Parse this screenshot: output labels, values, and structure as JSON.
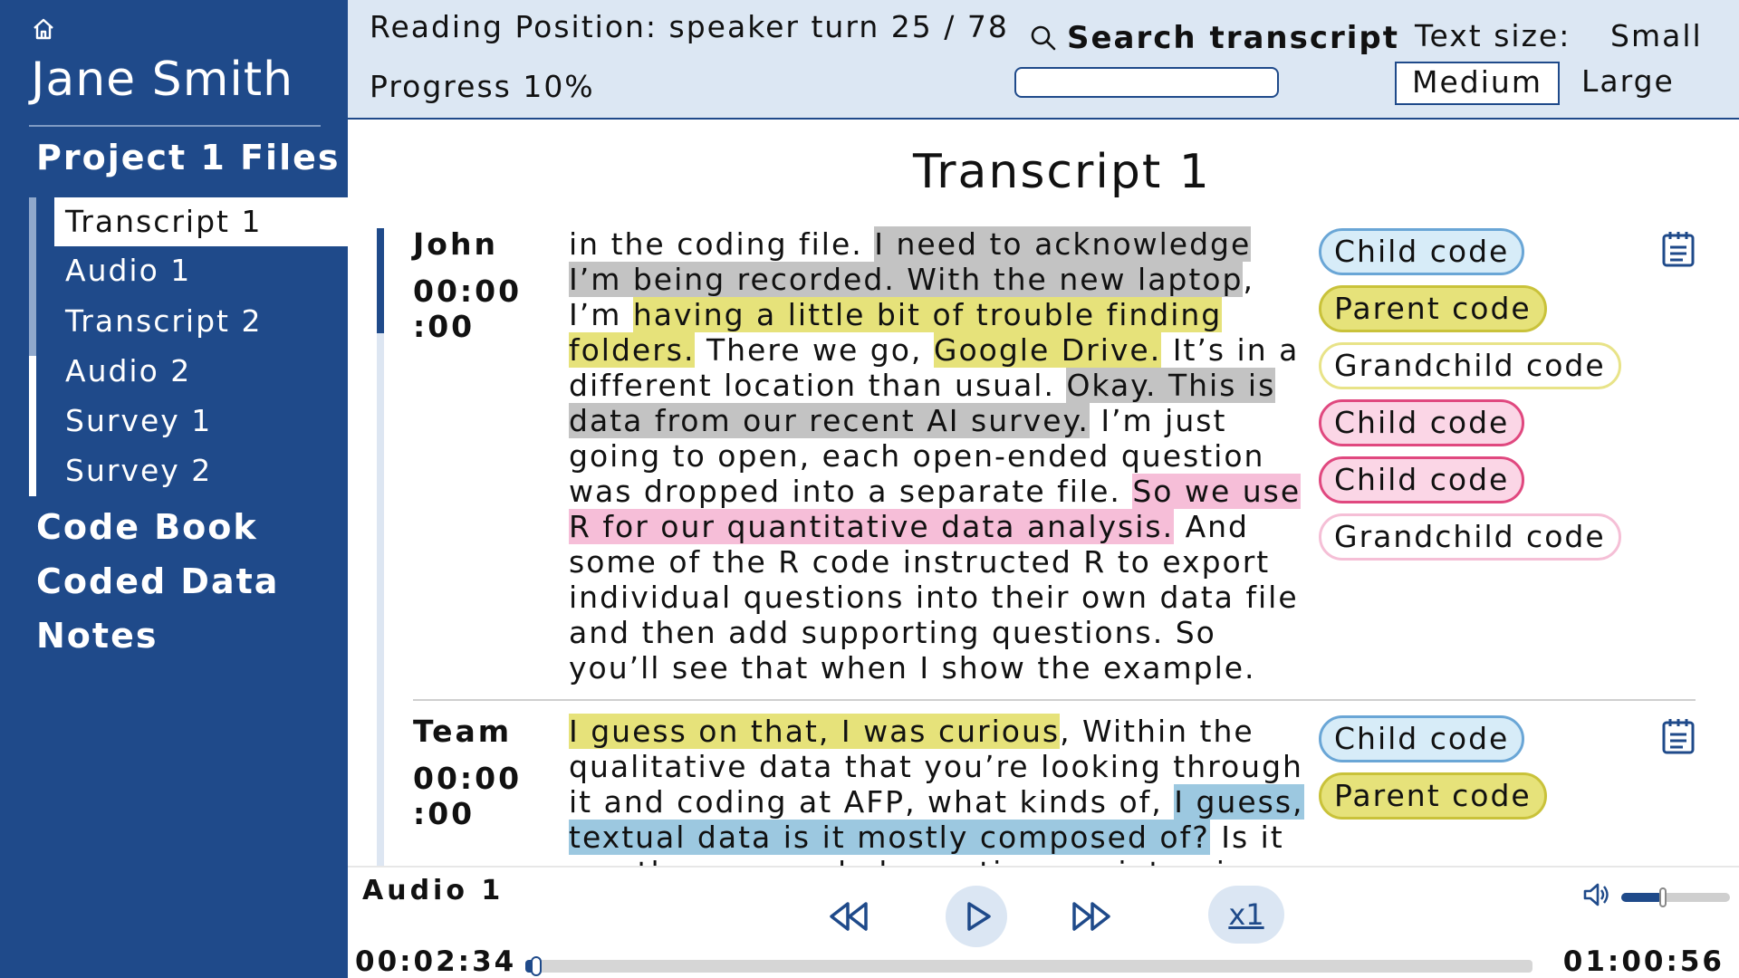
{
  "sidebar": {
    "user_name": "Jane Smith",
    "project_title": "Project 1 Files",
    "files": [
      {
        "label": "Transcript 1",
        "active": true
      },
      {
        "label": "Audio 1",
        "active": false
      },
      {
        "label": "Transcript 2",
        "active": false
      },
      {
        "label": "Audio 2",
        "active": false
      },
      {
        "label": "Survey 1",
        "active": false
      },
      {
        "label": "Survey 2",
        "active": false
      }
    ],
    "nav": [
      "Code Book",
      "Coded Data",
      "Notes"
    ]
  },
  "header": {
    "reading_position": "Reading Position: speaker turn 25 / 78",
    "progress": "Progress 10%",
    "search_label": "Search transcript",
    "search_value": "",
    "text_size_label": "Text size:",
    "text_size_options": [
      "Small",
      "Medium",
      "Large"
    ],
    "text_size_selected": "Medium"
  },
  "document": {
    "title": "Transcript 1",
    "turns": [
      {
        "speaker": "John",
        "time_line1": "00:00",
        "time_line2": ":00",
        "segments": [
          {
            "text": "in the coding file. ",
            "hl": ""
          },
          {
            "text": "I need to acknowledge I’m being recorded. With  the new laptop",
            "hl": "gray"
          },
          {
            "text": ", I’m ",
            "hl": ""
          },
          {
            "text": "having a little bit of trouble finding folders.",
            "hl": "yellow"
          },
          {
            "text": " There we go, ",
            "hl": ""
          },
          {
            "text": "Google Drive.",
            "hl": "yellow"
          },
          {
            "text": " It’s in a different location than usual.  ",
            "hl": ""
          },
          {
            "text": "Okay. This is data from our recent AI survey.",
            "hl": "gray"
          },
          {
            "text": " I’m just going to open, each open-ended question was dropped into a separate file. ",
            "hl": ""
          },
          {
            "text": "So we use R for our quantitative data analysis.",
            "hl": "pink"
          },
          {
            "text": " And some  of the R code instructed R to export individual questions into their own data file and then add supporting questions. So you’ll see that when I  show the example.",
            "hl": ""
          }
        ],
        "codes": [
          {
            "label": "Child code",
            "style": "child-blue"
          },
          {
            "label": "Parent code",
            "style": "parent-yellow"
          },
          {
            "label": "Grandchild code",
            "style": "grandchild-yellow"
          },
          {
            "label": "Child code",
            "style": "child-pink"
          },
          {
            "label": "Child code",
            "style": "child-pink"
          },
          {
            "label": "Grandchild code",
            "style": "grandchild-pink"
          }
        ]
      },
      {
        "speaker": "Team",
        "time_line1": "00:00",
        "time_line2": ":00",
        "segments": [
          {
            "text": "I guess on that, I was curious",
            "hl": "yellow"
          },
          {
            "text": ", Within the qualitative data that  you’re looking through it and coding at AFP, what kinds of, ",
            "hl": ""
          },
          {
            "text": "I guess, textual data is it mostly composed of?",
            "hl": "blue"
          },
          {
            "text": " Is it mostly open-ended questions or interviews,",
            "hl": ""
          }
        ],
        "codes": [
          {
            "label": "Child code",
            "style": "child-blue"
          },
          {
            "label": "Parent code",
            "style": "parent-yellow"
          }
        ]
      }
    ]
  },
  "player": {
    "title": "Audio 1",
    "speed": "x1",
    "current_time": "00:02:34",
    "total_time": "01:00:56",
    "progress_fraction": 0.011,
    "volume_fraction": 0.38
  },
  "colors": {
    "brand": "#1f4a8a",
    "highlight_gray": "#c3c3c3",
    "highlight_yellow": "#e6e27a",
    "highlight_pink": "#f6bed8",
    "highlight_blue": "#9cc8e0"
  },
  "icons": [
    "home-icon",
    "search-icon",
    "notepad-icon",
    "rewind-icon",
    "play-icon",
    "fast-forward-icon",
    "volume-icon"
  ]
}
